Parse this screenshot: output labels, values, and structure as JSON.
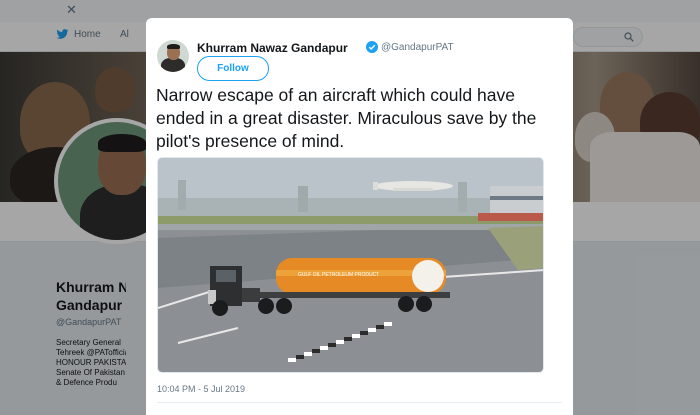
{
  "nav": {
    "home_label": "Home",
    "second_label": "Al"
  },
  "profile": {
    "name_line1": "Khurram N",
    "name_line2": "Gandapur",
    "handle": "@GandapurPAT",
    "bio_lines": [
      "Secretary General",
      "Tehreek @PATofficial",
      "HONOUR PAKISTAN",
      "Senate Of Pakistan",
      "& Defence Produ"
    ]
  },
  "tweet": {
    "author_name": "Khurram Nawaz Gandapur",
    "author_handle": "@GandapurPAT",
    "follow_label": "Follow",
    "text": "Narrow escape of an aircraft which could have ended in a great disaster. Miraculous save by the pilot's presence of mind.",
    "timestamp": "10:04 PM - 5 Jul 2019",
    "media_alt_text": "GULF OIL PETROLEUM PRODUCT"
  },
  "colors": {
    "twitter_blue": "#1da1f2",
    "text_primary": "#14171a",
    "text_secondary": "#657786"
  },
  "icons": [
    "twitter-bird-icon",
    "close-icon",
    "verified-badge-icon",
    "search-icon"
  ]
}
